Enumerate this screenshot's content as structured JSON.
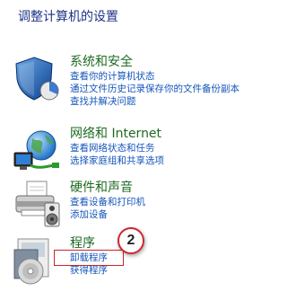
{
  "page_title": "调整计算机的设置",
  "categories": [
    {
      "title": "系统和安全",
      "icon": "shield-icon",
      "links": [
        "查看你的计算机状态",
        "通过文件历史记录保存你的文件备份副本",
        "查找并解决问题"
      ]
    },
    {
      "title": "网络和 Internet",
      "icon": "network-globe-icon",
      "links": [
        "查看网络状态和任务",
        "选择家庭组和共享选项"
      ]
    },
    {
      "title": "硬件和声音",
      "icon": "printer-icon",
      "links": [
        "查看设备和打印机",
        "添加设备"
      ]
    },
    {
      "title": "程序",
      "icon": "programs-disc-icon",
      "links": [
        "卸载程序",
        "获得程序"
      ]
    }
  ],
  "annotation": {
    "step_number": "2",
    "highlight_color": "#c8262a"
  },
  "colors": {
    "title": "#1e3287",
    "category_title": "#1e6a22",
    "link": "#1556bb"
  }
}
